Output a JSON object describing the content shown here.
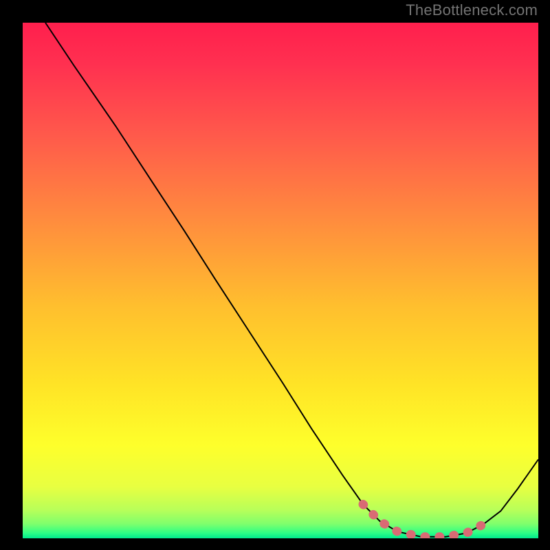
{
  "watermark": "TheBottleneck.com",
  "chart_data": {
    "type": "line",
    "title": "",
    "xlabel": "",
    "ylabel": "",
    "xlim": [
      0,
      100
    ],
    "ylim": [
      0,
      100
    ],
    "curve": [
      {
        "x": 4.4,
        "y": 100.0
      },
      {
        "x": 10.0,
        "y": 91.6
      },
      {
        "x": 18.0,
        "y": 80.0
      },
      {
        "x": 25.0,
        "y": 69.3
      },
      {
        "x": 31.3,
        "y": 59.7
      },
      {
        "x": 37.3,
        "y": 50.3
      },
      {
        "x": 44.0,
        "y": 40.0
      },
      {
        "x": 50.5,
        "y": 30.0
      },
      {
        "x": 56.0,
        "y": 21.3
      },
      {
        "x": 62.0,
        "y": 12.3
      },
      {
        "x": 66.0,
        "y": 6.6
      },
      {
        "x": 69.3,
        "y": 3.3
      },
      {
        "x": 72.7,
        "y": 1.3
      },
      {
        "x": 77.3,
        "y": 0.3
      },
      {
        "x": 82.0,
        "y": 0.3
      },
      {
        "x": 86.0,
        "y": 1.0
      },
      {
        "x": 89.3,
        "y": 2.7
      },
      {
        "x": 92.7,
        "y": 5.3
      },
      {
        "x": 96.0,
        "y": 9.6
      },
      {
        "x": 100.0,
        "y": 15.3
      }
    ],
    "highlight_band": [
      {
        "x": 66.0,
        "y": 6.6
      },
      {
        "x": 69.3,
        "y": 3.3
      },
      {
        "x": 72.7,
        "y": 1.3
      },
      {
        "x": 77.3,
        "y": 0.3
      },
      {
        "x": 82.0,
        "y": 0.3
      },
      {
        "x": 86.0,
        "y": 1.0
      },
      {
        "x": 89.3,
        "y": 2.7
      }
    ],
    "gradient_stops": [
      {
        "pos": 0.0,
        "color": "#ff1f4d"
      },
      {
        "pos": 0.08,
        "color": "#ff3050"
      },
      {
        "pos": 0.22,
        "color": "#ff5a4b"
      },
      {
        "pos": 0.38,
        "color": "#ff8b3e"
      },
      {
        "pos": 0.55,
        "color": "#ffbf2e"
      },
      {
        "pos": 0.7,
        "color": "#ffe326"
      },
      {
        "pos": 0.82,
        "color": "#feff2b"
      },
      {
        "pos": 0.9,
        "color": "#e8ff41"
      },
      {
        "pos": 0.945,
        "color": "#b8ff59"
      },
      {
        "pos": 0.972,
        "color": "#7fff6c"
      },
      {
        "pos": 0.99,
        "color": "#2cff86"
      },
      {
        "pos": 1.0,
        "color": "#00e98e"
      }
    ],
    "highlight_color": "#d96b74",
    "line_color": "#000000"
  }
}
